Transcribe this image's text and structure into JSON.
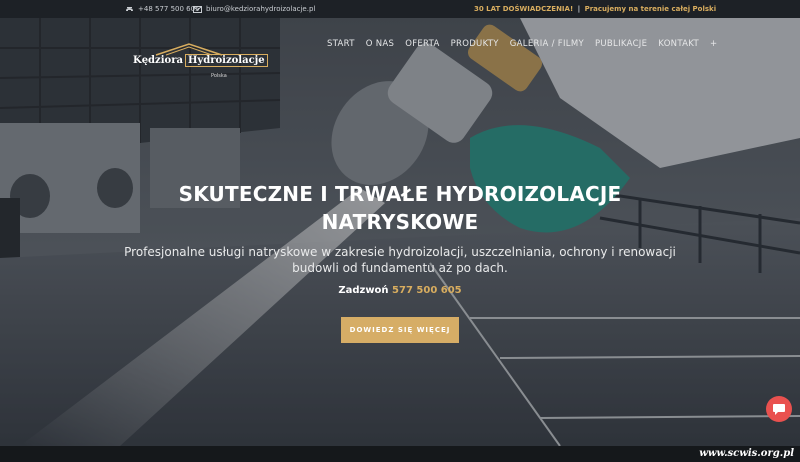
{
  "topbar": {
    "phone": "+48 577 500 605",
    "phone_icon": "phone-icon",
    "email": "biuro@kedziorahydroizolacje.pl",
    "email_icon": "mail-icon",
    "tagline_part1": "30 LAT DOŚWIADCZENIA!",
    "tagline_sep": "|",
    "tagline_part2": "Pracujemy na terenie całej Polski"
  },
  "logo": {
    "word1": "Kędziora",
    "word2": "Hydroizolacje",
    "sub": "Polska"
  },
  "nav": {
    "items": [
      "START",
      "O NAS",
      "OFERTA",
      "PRODUKTY",
      "GALERIA / FILMY",
      "PUBLIKACJE",
      "KONTAKT",
      "+"
    ]
  },
  "hero": {
    "headline_line1": "SKUTECZNE I TRWAŁE HYDROIZOLACJE",
    "headline_line2": "NATRYSKOWE",
    "lead": "Profesjonalne usługi natryskowe w zakresie hydroizolacji, uszczelniania, ochrony i renowacji budowli od fundamentu aż po dach.",
    "call_label": "Zadzwoń",
    "call_number": "577 500 605",
    "cta": "DOWIEDZ SIĘ WIĘCEJ"
  },
  "chat_icon": "chat-bubble-icon",
  "watermark": "www.scwis.org.pl",
  "colors": {
    "accent": "#d6ad66",
    "topbar_bg": "#1d2126",
    "chat": "#e9514f"
  }
}
